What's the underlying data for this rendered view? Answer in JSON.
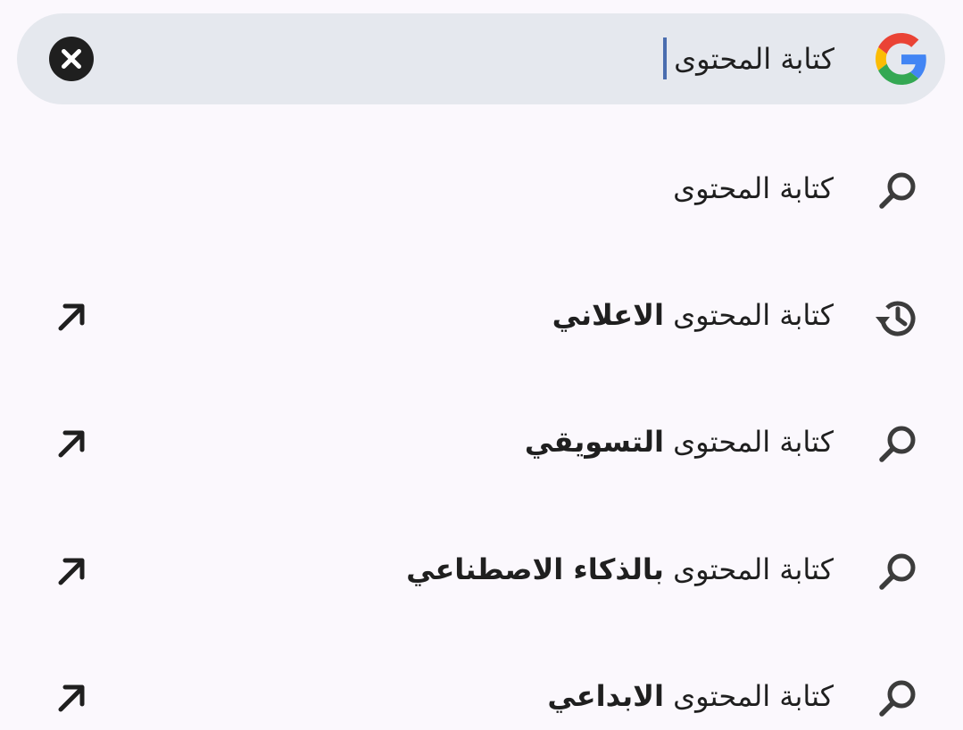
{
  "search": {
    "query": "كتابة المحتوى",
    "logo_icon": "google-g-icon",
    "clear_icon": "close-circle-icon",
    "colors": {
      "bar": "#E5E8EE",
      "caret": "#4A6DAF",
      "text": "#1F1F1F"
    }
  },
  "suggestions": [
    {
      "icon": "search-icon",
      "prefix": "كتابة المحتوى",
      "bold": "",
      "has_fill_arrow": false
    },
    {
      "icon": "history-icon",
      "prefix": "كتابة المحتوى",
      "bold": "الاعلاني",
      "has_fill_arrow": true
    },
    {
      "icon": "search-icon",
      "prefix": "كتابة المحتوى",
      "bold": "التسويقي",
      "has_fill_arrow": true
    },
    {
      "icon": "search-icon",
      "prefix": "كتابة المحتوى",
      "bold": "بالذكاء الاصطناعي",
      "has_fill_arrow": true
    },
    {
      "icon": "search-icon",
      "prefix": "كتابة المحتوى",
      "bold": "الابداعي",
      "has_fill_arrow": true
    }
  ]
}
